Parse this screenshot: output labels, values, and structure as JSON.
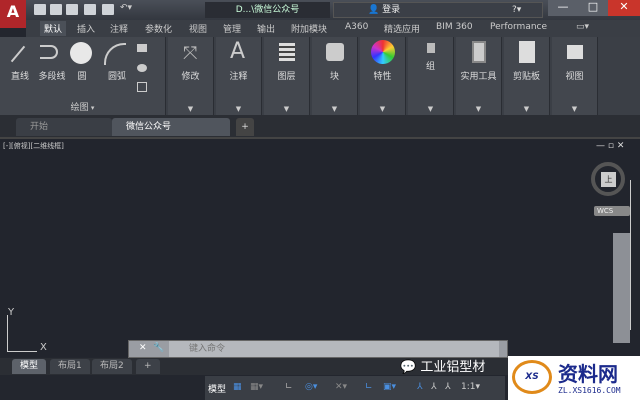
{
  "titlebar": {
    "app_logo": "A",
    "doc_title": "D...\\微信公众号",
    "search_label": "登录",
    "window_controls": [
      "minimize",
      "maximize",
      "close"
    ]
  },
  "ribbon_tabs": [
    "默认",
    "插入",
    "注释",
    "参数化",
    "视图",
    "管理",
    "输出",
    "附加模块",
    "A360",
    "精选应用",
    "BIM 360",
    "Performance"
  ],
  "draw_panel": {
    "tools": [
      "直线",
      "多段线",
      "圆",
      "圆弧"
    ],
    "footer": "绘图"
  },
  "panels": [
    "修改",
    "注释",
    "图层",
    "块",
    "特性",
    "组",
    "实用工具",
    "剪贴板",
    "视图"
  ],
  "doc_tabs": [
    "开始",
    "微信公众号"
  ],
  "viewport": {
    "label": "[-][俯视][二维线框]",
    "viewcube_face": "上",
    "wcs": "WCS",
    "axis_x": "X",
    "axis_y": "Y"
  },
  "command": {
    "placeholder": "键入命令"
  },
  "layout_tabs": [
    "模型",
    "布局1",
    "布局2"
  ],
  "statusbar": {
    "model": "模型",
    "scale": "1:1"
  },
  "watermark": {
    "text": "工业铝型材",
    "logo": "资料网",
    "url": "ZL.XS1616.COM"
  }
}
